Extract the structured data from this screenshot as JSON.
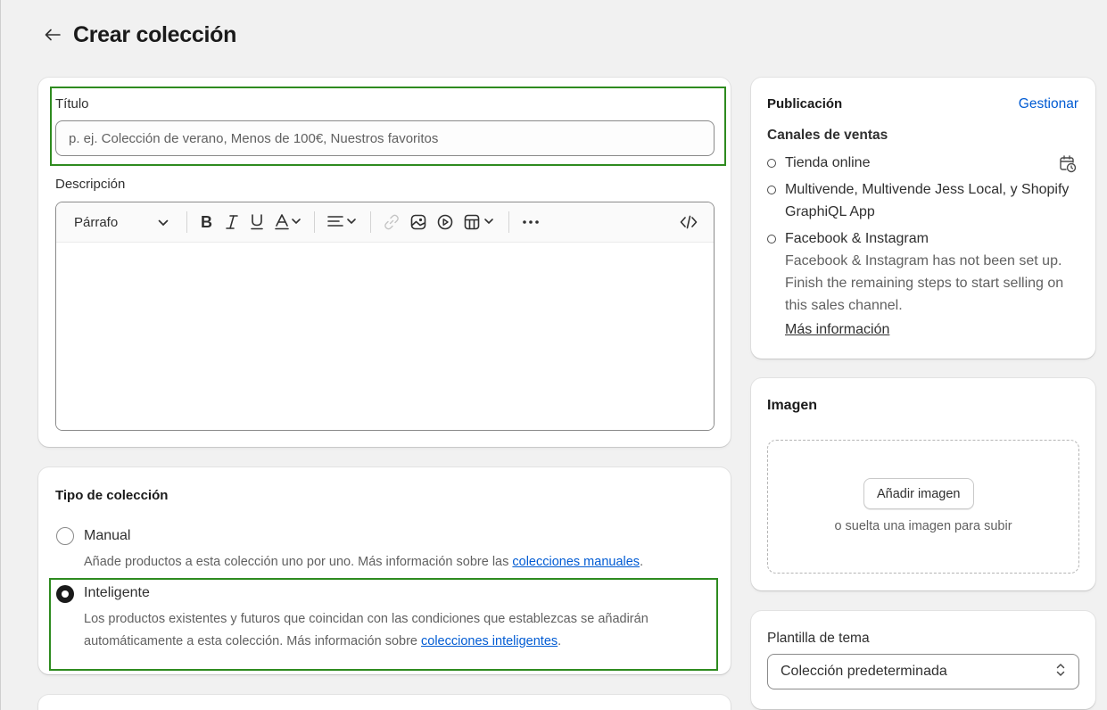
{
  "header": {
    "title": "Crear colección"
  },
  "main": {
    "title_label": "Título",
    "title_placeholder": "p. ej. Colección de verano, Menos de 100€, Nuestros favoritos",
    "description_label": "Descripción",
    "toolbar": {
      "paragraph_select": "Párrafo"
    }
  },
  "collection_type": {
    "heading": "Tipo de colección",
    "manual": {
      "label": "Manual",
      "help_prefix": "Añade productos a esta colección uno por uno. Más información sobre las ",
      "help_link": "colecciones manuales",
      "help_suffix": "."
    },
    "smart": {
      "label": "Inteligente",
      "selected": true,
      "help_prefix": "Los productos existentes y futuros que coincidan con las condiciones que establezcas se añadirán automáticamente a esta colección. Más información sobre ",
      "help_link": "colecciones inteligentes",
      "help_suffix": "."
    }
  },
  "publication": {
    "title": "Publicación",
    "manage": "Gestionar",
    "channels_heading": "Canales de ventas",
    "channels": [
      {
        "name": "Tienda online"
      },
      {
        "name": "Multivende, Multivende Jess Local, y Shopify GraphiQL App"
      },
      {
        "name": "Facebook & Instagram",
        "note": "Facebook & Instagram has not been set up. Finish the remaining steps to start selling on this sales channel.",
        "link": "Más información"
      }
    ]
  },
  "image": {
    "title": "Imagen",
    "add_button": "Añadir imagen",
    "drop_hint": "o suelta una imagen para subir"
  },
  "template": {
    "label": "Plantilla de tema",
    "value": "Colección predeterminada"
  },
  "colors": {
    "accent_link": "#005bd3",
    "highlight_border": "#2e8b1f",
    "text": "#303030"
  },
  "icons": [
    "arrow-left-icon",
    "chevron-down-icon",
    "bold-icon",
    "italic-icon",
    "underline-icon",
    "text-color-icon",
    "align-icon",
    "link-icon",
    "image-icon",
    "video-icon",
    "table-icon",
    "more-icon",
    "code-icon",
    "schedule-icon",
    "select-arrows-icon"
  ]
}
